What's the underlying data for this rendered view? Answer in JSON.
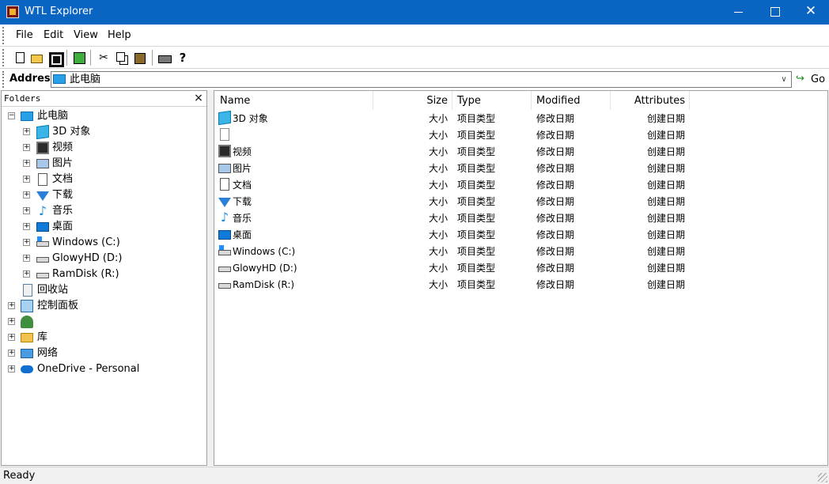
{
  "window": {
    "title": "WTL Explorer",
    "close_glyph": "✕"
  },
  "menu": [
    "File",
    "Edit",
    "View",
    "Help"
  ],
  "toolbar": {
    "cut_glyph": "✂",
    "help_glyph": "?"
  },
  "address": {
    "label": "Address",
    "value": "此电脑",
    "dropdown_glyph": "∨",
    "go_arrow": "↪",
    "go_label": "Go"
  },
  "tree": {
    "title": "Folders",
    "close_glyph": "×",
    "root": {
      "label": "此电脑",
      "expander": "−"
    },
    "children": [
      {
        "label": "3D 对象",
        "expander": "+",
        "icon": "3d-objects-icon"
      },
      {
        "label": "视频",
        "expander": "+",
        "icon": "videos-icon"
      },
      {
        "label": "图片",
        "expander": "+",
        "icon": "pictures-icon"
      },
      {
        "label": "文档",
        "expander": "+",
        "icon": "documents-icon"
      },
      {
        "label": "下载",
        "expander": "+",
        "icon": "downloads-icon"
      },
      {
        "label": "音乐",
        "expander": "+",
        "icon": "music-icon",
        "glyph": "♪"
      },
      {
        "label": "桌面",
        "expander": "+",
        "icon": "desktop-icon"
      },
      {
        "label": "Windows (C:)",
        "expander": "+",
        "icon": "system-drive-icon"
      },
      {
        "label": "GlowyHD (D:)",
        "expander": "+",
        "icon": "drive-icon"
      },
      {
        "label": "RamDisk (R:)",
        "expander": "+",
        "icon": "drive-icon"
      }
    ],
    "top_level": [
      {
        "label": "回收站",
        "expander": "",
        "icon": "recycle-bin-icon"
      },
      {
        "label": "控制面板",
        "expander": "+",
        "icon": "control-panel-icon"
      },
      {
        "label": "",
        "expander": "+",
        "icon": "user-icon"
      },
      {
        "label": "库",
        "expander": "+",
        "icon": "libraries-icon"
      },
      {
        "label": "网络",
        "expander": "+",
        "icon": "network-icon"
      },
      {
        "label": "OneDrive - Personal",
        "expander": "+",
        "icon": "onedrive-icon"
      }
    ]
  },
  "list": {
    "columns": [
      "Name",
      "Size",
      "Type",
      "Modified",
      "Attributes"
    ],
    "rows": [
      {
        "name": "3D 对象",
        "size": "大小",
        "type": "项目类型",
        "modified": "修改日期",
        "attributes": "创建日期",
        "icon": "3d-objects-icon"
      },
      {
        "name": "",
        "size": "大小",
        "type": "项目类型",
        "modified": "修改日期",
        "attributes": "创建日期",
        "icon": "blank-file-icon"
      },
      {
        "name": "视频",
        "size": "大小",
        "type": "项目类型",
        "modified": "修改日期",
        "attributes": "创建日期",
        "icon": "videos-icon"
      },
      {
        "name": "图片",
        "size": "大小",
        "type": "项目类型",
        "modified": "修改日期",
        "attributes": "创建日期",
        "icon": "pictures-icon"
      },
      {
        "name": "文档",
        "size": "大小",
        "type": "项目类型",
        "modified": "修改日期",
        "attributes": "创建日期",
        "icon": "documents-icon"
      },
      {
        "name": "下载",
        "size": "大小",
        "type": "项目类型",
        "modified": "修改日期",
        "attributes": "创建日期",
        "icon": "downloads-icon"
      },
      {
        "name": "音乐",
        "size": "大小",
        "type": "项目类型",
        "modified": "修改日期",
        "attributes": "创建日期",
        "icon": "music-icon",
        "glyph": "♪"
      },
      {
        "name": "桌面",
        "size": "大小",
        "type": "项目类型",
        "modified": "修改日期",
        "attributes": "创建日期",
        "icon": "desktop-icon"
      },
      {
        "name": "Windows (C:)",
        "size": "大小",
        "type": "项目类型",
        "modified": "修改日期",
        "attributes": "创建日期",
        "icon": "system-drive-icon"
      },
      {
        "name": "GlowyHD (D:)",
        "size": "大小",
        "type": "项目类型",
        "modified": "修改日期",
        "attributes": "创建日期",
        "icon": "drive-icon"
      },
      {
        "name": "RamDisk (R:)",
        "size": "大小",
        "type": "项目类型",
        "modified": "修改日期",
        "attributes": "创建日期",
        "icon": "drive-icon"
      }
    ]
  },
  "status": {
    "text": "Ready"
  },
  "colors": {
    "titlebar": "#0a64c2",
    "window": "#ffffff",
    "chrome": "#f0f0f0"
  }
}
